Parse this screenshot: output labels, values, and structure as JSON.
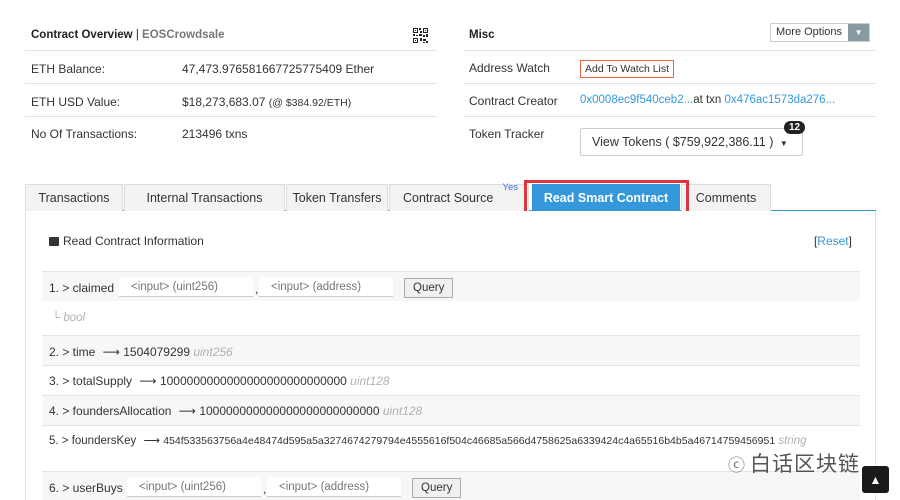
{
  "overview": {
    "title": "Contract Overview",
    "separator": "|",
    "subtitle": "EOSCrowdsale",
    "rows": [
      {
        "label": "ETH Balance:",
        "value": "47,473.976581667725775409 Ether"
      },
      {
        "label": "ETH USD Value:",
        "value": "$18,273,683.07",
        "note": "(@ $384.92/ETH)"
      },
      {
        "label": "No Of Transactions:",
        "value": "213496 txns"
      }
    ]
  },
  "misc": {
    "title": "Misc",
    "more_options": "More Options",
    "address_watch_label": "Address Watch",
    "watch_button": "Add To Watch List",
    "creator_label": "Contract Creator",
    "creator_address": "0x0008ec9f540ceb2...",
    "at_txn": "at txn",
    "creator_txn": "0x476ac1573da276...",
    "token_tracker_label": "Token Tracker",
    "view_tokens": "View Tokens ( $759,922,386.11 )",
    "token_count": "12"
  },
  "tabs": [
    {
      "label": "Transactions"
    },
    {
      "label": "Internal Transactions"
    },
    {
      "label": "Token Transfers"
    },
    {
      "label": "Contract Source",
      "sup": "Yes"
    },
    {
      "label": "Read Smart Contract"
    },
    {
      "label": "Comments"
    }
  ],
  "read_contract": {
    "title": "Read Contract Information",
    "reset_open": "[",
    "reset": "Reset",
    "reset_close": "]",
    "functions": [
      {
        "name": "1. > claimed",
        "inputs": [
          "<input> (uint256)",
          "<input> (address)"
        ],
        "button": "Query",
        "output_type": "bool"
      },
      {
        "name": "2. > time",
        "arrow": "⟶",
        "value": "1504079299",
        "type": "uint256"
      },
      {
        "name": "3. > totalSupply",
        "arrow": "⟶",
        "value": "1000000000000000000000000000",
        "type": "uint128"
      },
      {
        "name": "4. > foundersAllocation",
        "arrow": "⟶",
        "value": "100000000000000000000000000",
        "type": "uint128"
      },
      {
        "name": "5. > foundersKey",
        "arrow": "⟶",
        "value": "454f533563756a4e48474d595a5a3274674279794e4555616f504c46685a566d4758625a6339424c4a65516b4b5a46714759456951",
        "type": "string"
      },
      {
        "name": "6. > userBuys",
        "inputs": [
          "<input> (uint256)",
          "<input> (address)"
        ],
        "button": "Query"
      }
    ]
  },
  "watermark": "白话区块链",
  "colors": {
    "accent": "#3498db",
    "highlight": "#e0353d",
    "watch_border": "#e8663d"
  }
}
